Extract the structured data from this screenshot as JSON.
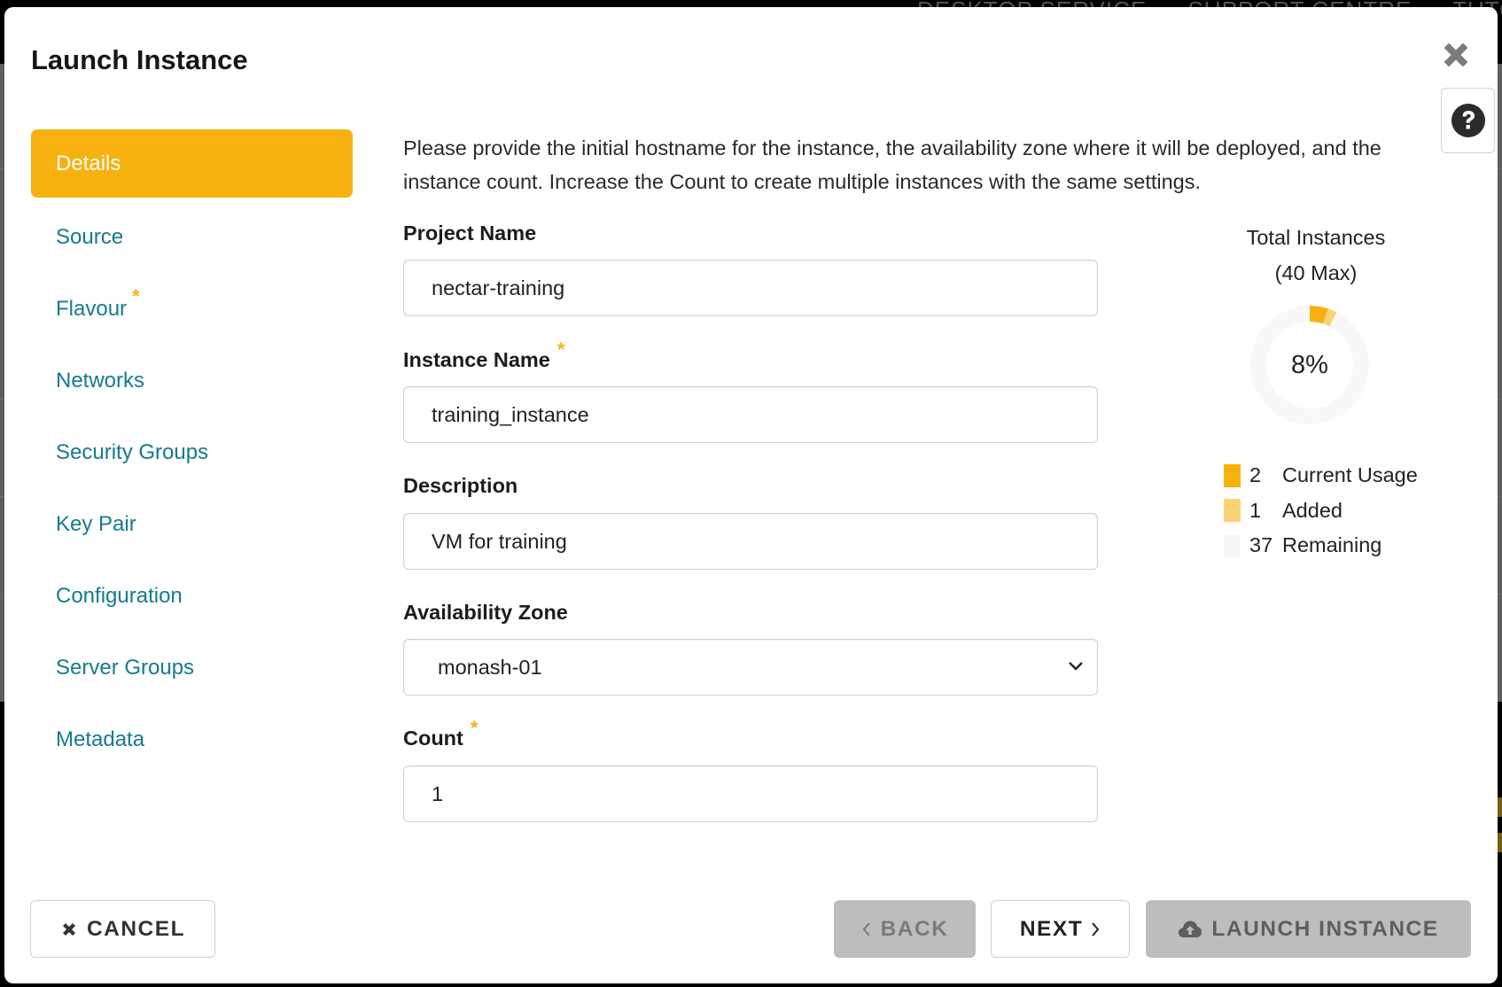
{
  "background": {
    "nav_items": [
      "DESKTOP SERVICE",
      "SUPPORT CENTRE",
      "TUTO"
    ]
  },
  "dialog": {
    "title": "Launch Instance",
    "close_icon": "close-icon",
    "help_icon": "question-circle-icon"
  },
  "sidebar": {
    "items": [
      {
        "label": "Details",
        "active": true,
        "required": false
      },
      {
        "label": "Source",
        "active": false,
        "required": false
      },
      {
        "label": "Flavour",
        "active": false,
        "required": true
      },
      {
        "label": "Networks",
        "active": false,
        "required": false
      },
      {
        "label": "Security Groups",
        "active": false,
        "required": false
      },
      {
        "label": "Key Pair",
        "active": false,
        "required": false
      },
      {
        "label": "Configuration",
        "active": false,
        "required": false
      },
      {
        "label": "Server Groups",
        "active": false,
        "required": false
      },
      {
        "label": "Metadata",
        "active": false,
        "required": false
      }
    ],
    "required_marker": "*"
  },
  "form": {
    "intro": "Please provide the initial hostname for the instance, the availability zone where it will be deployed, and the instance count. Increase the Count to create multiple instances with the same settings.",
    "project_name": {
      "label": "Project Name",
      "value": "nectar-training"
    },
    "instance_name": {
      "label": "Instance Name",
      "value": "training_instance",
      "required": true
    },
    "description": {
      "label": "Description",
      "value": "VM for training"
    },
    "availability_zone": {
      "label": "Availability Zone",
      "selected": "monash-01"
    },
    "count": {
      "label": "Count",
      "value": "1",
      "required": true
    }
  },
  "quota": {
    "title": "Total Instances",
    "subtitle": "(40 Max)",
    "percent_label": "8%",
    "max": 40,
    "legend": [
      {
        "value": "2",
        "label": "Current Usage",
        "color": "#f7b10f"
      },
      {
        "value": "1",
        "label": "Added",
        "color": "#fad276"
      },
      {
        "value": "37",
        "label": "Remaining",
        "color": "#f8f8f8"
      }
    ]
  },
  "chart_data": {
    "type": "pie",
    "title": "Total Instances",
    "subtitle": "(40 Max)",
    "center_label": "8%",
    "categories": [
      "Current Usage",
      "Added",
      "Remaining"
    ],
    "values": [
      2,
      1,
      37
    ],
    "colors": [
      "#f7b10f",
      "#fad276",
      "#f8f8f8"
    ],
    "total": 40,
    "legend_position": "bottom"
  },
  "footer": {
    "cancel_label": "CANCEL",
    "back_label": "BACK",
    "next_label": "NEXT",
    "launch_label": "LAUNCH INSTANCE"
  },
  "colors": {
    "accent": "#f7b10f",
    "link": "#137b8f",
    "disabled_button": "#bdbdbd"
  }
}
